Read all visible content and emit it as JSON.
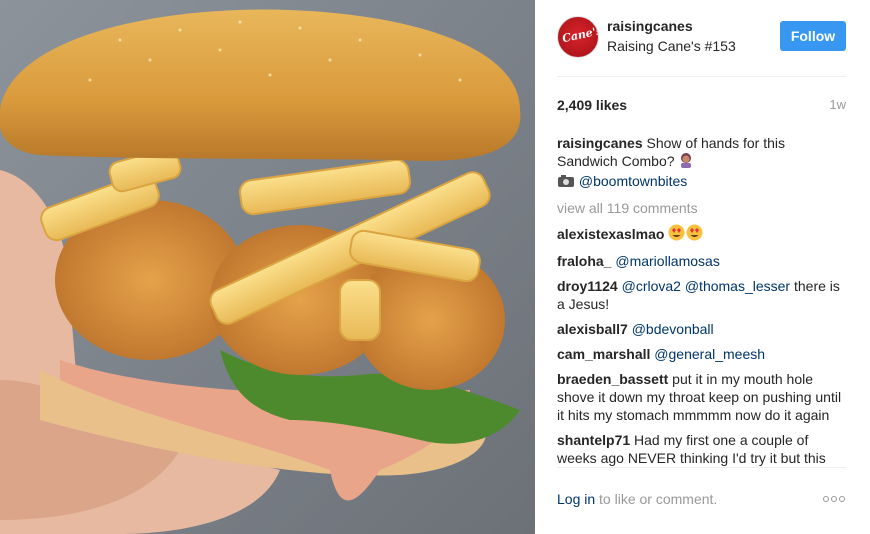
{
  "post": {
    "account": {
      "username": "raisingcanes",
      "location": "Raising Cane's #153",
      "avatar_text": "Cane's",
      "follow_label": "Follow"
    },
    "likes": "2,409 likes",
    "time_ago": "1w",
    "caption": {
      "username": "raisingcanes",
      "text": "Show of hands for this Sandwich Combo?",
      "camera_mention": "@boomtownbites"
    },
    "view_all": "view all 119 comments",
    "comments": [
      {
        "user": "alexistexaslmao",
        "segments": [],
        "emoji": "heart-eyes"
      },
      {
        "user": "fraloha_",
        "segments": [
          {
            "type": "mention",
            "text": "@mariollamosas"
          }
        ]
      },
      {
        "user": "droy1124",
        "segments": [
          {
            "type": "mention",
            "text": "@crlova2"
          },
          {
            "type": "text",
            "text": " "
          },
          {
            "type": "mention",
            "text": "@thomas_lesser"
          },
          {
            "type": "text",
            "text": " there is a Jesus!"
          }
        ]
      },
      {
        "user": "alexisball7",
        "segments": [
          {
            "type": "mention",
            "text": "@bdevonball"
          }
        ]
      },
      {
        "user": "cam_marshall",
        "segments": [
          {
            "type": "mention",
            "text": "@general_meesh"
          }
        ]
      },
      {
        "user": "braeden_bassett",
        "segments": [
          {
            "type": "text",
            "text": "put it in my mouth hole shove it down my throat keep on pushing until it hits my stomach mmmmm now do it again"
          }
        ]
      },
      {
        "user": "shantelp71",
        "segments": [
          {
            "type": "text",
            "text": "Had my first one a couple of weeks ago NEVER thinking I'd try it but this"
          }
        ]
      }
    ],
    "login_link": "Log in",
    "login_text": " to like or comment.",
    "colors": {
      "follow": "#3897f0",
      "mention": "#003569",
      "muted": "#999999"
    }
  }
}
